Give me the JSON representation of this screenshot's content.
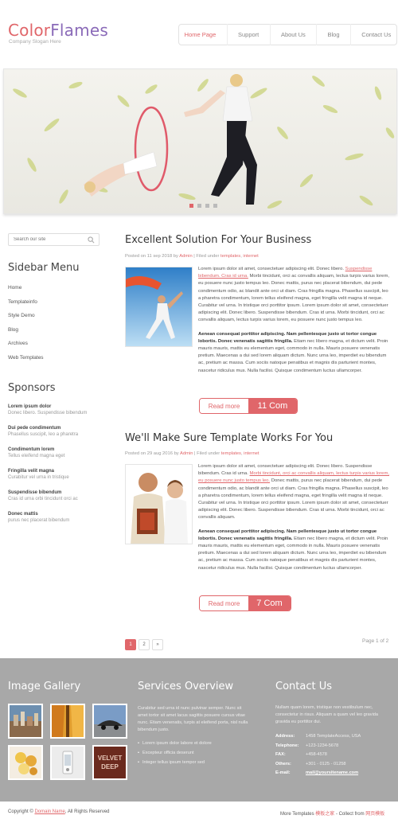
{
  "header": {
    "logo_part1": "Color",
    "logo_part2": "Flames",
    "slogan": "Company Slogan Here",
    "nav": [
      "Home Page",
      "Support",
      "About Us",
      "Blog",
      "Contact Us"
    ],
    "nav_active": "Home Page"
  },
  "slider": {
    "dot_count": 4,
    "active_dot": 1
  },
  "sidebar": {
    "search_placeholder": "Search our site",
    "menu_title": "Sidebar Menu",
    "menu": [
      "Home",
      "Templateinfo",
      "Style Demo",
      "Blog",
      "Archives",
      "Web Templates"
    ],
    "sponsors_title": "Sponsors",
    "sponsors": [
      {
        "name": "Lorem ipsum dolor",
        "desc": "Donec libero. Suspendisse bibendum"
      },
      {
        "name": "Dui pede condimentum",
        "desc": "Phasellus suscipit, leo a pharetra"
      },
      {
        "name": "Condimentum lorem",
        "desc": "Tellus eleifend magna eget"
      },
      {
        "name": "Fringilla velit magna",
        "desc": "Curabitur vel urna in tristique"
      },
      {
        "name": "Suspendisse bibendum",
        "desc": "Cras id urna orbi tincidunt orci ac"
      },
      {
        "name": "Donec mattis",
        "desc": "purus nec placerat bibendum"
      }
    ]
  },
  "posts": [
    {
      "title": "Excellent Solution For Your Business",
      "meta_posted": "Posted on 11 sep 2018 by",
      "meta_author": "Admin",
      "meta_filed": "|   Filed under",
      "meta_cat1": "templates",
      "meta_cat2": "internet",
      "p1_a": "Lorem ipsum dolor sit amet, consectetuer adipiscing elit. Donec libero.",
      "p1_link": "Suspendisse bibendum. Cras id urna.",
      "p1_b": "Morbi tincidunt, orci ac convallis aliquam, lectus turpis varius lorem, eu posuere nunc justo tempus leo. Donec mattis, purus nec placerat bibendum, dui pede condimentum odio, ac blandit ante orci ut diam. Cras fringilla magna. Phasellus suscipit, leo a pharetra condimentum, lorem tellus eleifend magna, eget fringilla velit magna id neque. Curabitur vel urna. In tristique orci porttitor ipsum. Lorem ipsum dolor sit amet, consectetuer adipiscing elit. Donec libero. Suspendisse bibendum. Cras id urna. Morbi tincidunt, orci ac convallis aliquam, lectus turpis varius lorem, eu posuere nunc justo tempus leo.",
      "p2_bold": "Aenean consequat porttitor adipiscing. Nam pellentesque justo ut tortor congue lobortis. Donec venenatis sagittis fringilla.",
      "p2_rest": "Etiam nec libero magna, et dictum velit. Proin mauris mauris, mattis eu elementum eget, commodo in nulla. Mauris posuere venenatis pretium. Maecenas a dui sed lorem aliquam dictum. Nunc urna leo, imperdiet eu bibendum ac, pretium ac massa. Cum sociis natoque penatibus et magnis dis parturient montes, nascetur ridiculus mus. Nulla facilisi. Quisque condimentum luctus ullamcorper.",
      "read_more": "Read more",
      "comments": "11 Com"
    },
    {
      "title": "We'll Make Sure Template Works For You",
      "meta_posted": "Posted on 29 aug 2016 by",
      "meta_author": "Admin",
      "meta_filed": "|   Filed under",
      "meta_cat1": "templates",
      "meta_cat2": "internet",
      "p1_a": "Lorem ipsum dolor sit amet, consectetuer adipiscing elit. Donec libero. Suspendisse bibendum. Cras id urna.",
      "p1_link": "Morbi tincidunt, orci ac convallis aliquam, lectus turpis varius lorem, eu posuere nunc justo tempus leo.",
      "p1_b": "Donec mattis, purus nec placerat bibendum, dui pede condimentum odio, ac blandit ante orci ut diam. Cras fringilla magna. Phasellus suscipit, leo a pharetra condimentum, lorem tellus eleifend magna, eget fringilla velit magna id neque. Curabitur vel urna. In tristique orci porttitor ipsum. Lorem ipsum dolor sit amet, consectetuer adipiscing elit. Donec libero. Suspendisse bibendum. Cras id urna. Morbi tincidunt, orci ac convallis aliquam.",
      "p2_bold": "Aenean consequat porttitor adipiscing. Nam pellentesque justo ut tortor congue lobortis. Donec venenatis sagittis fringilla.",
      "p2_rest": "Etiam nec libero magna, et dictum velit. Proin mauris mauris, mattis eu elementum eget, commodo in nulla. Mauris posuere venenatis pretium. Maecenas a dui sed lorem aliquam dictum. Nunc urna leo, imperdiet eu bibendum ac, pretium ac massa. Cum sociis natoque penatibus et magnis dis parturient montes, nascetur ridiculus mus. Nulla facilisi. Quisque condimentum luctus ullamcorper.",
      "read_more": "Read more",
      "comments": "7 Com"
    }
  ],
  "pager": {
    "pages": [
      "1",
      "2",
      "»"
    ],
    "active": "1",
    "page_of": "Page 1 of 2"
  },
  "footer": {
    "gallery_title": "Image Gallery",
    "services_title": "Services Overview",
    "services_text": "Curabitur sed urna id nunc pulvinar semper. Nunc sit amet tortor sit amet lacus sagittis posuere cursus vitae nunc. Etiam venenatis, turpis at eleifend porta, nisl nulla bibendum justo.",
    "services_list": [
      "Lorem ipsum dolor labore et dolore",
      "Excepteur officia deserunt",
      "Integer tellus ipsum tempor sed"
    ],
    "contact_title": "Contact Us",
    "contact_text": "Nullam quam lorem, tristique non vestibulum nec, consectetur in risus. Aliquam a quam vel leo gravida gravida eu porttitor dui.",
    "contact": [
      {
        "k": "Address:",
        "v": "1458 TemplateAccess, USA"
      },
      {
        "k": "Telephone:",
        "v": "+123-1234-5678"
      },
      {
        "k": "FAX:",
        "v": "+458-4578"
      },
      {
        "k": "Others:",
        "v": "+301 - 0125 - 01258"
      },
      {
        "k": "E-mail:",
        "v": "mail@yoursitename.com"
      }
    ]
  },
  "bottom": {
    "copy_a": "Copyright ©",
    "copy_link": "Domain Name",
    "copy_b": "All Rights Reserved",
    "credits_a": "More Templates",
    "credits_link1": "模板之家",
    "credits_b": "- Collect from",
    "credits_link2": "网页模板"
  },
  "colors": {
    "accent": "#e0666a",
    "logo_purple": "#8a6ab8",
    "footer_bg": "#a8a8a8"
  }
}
